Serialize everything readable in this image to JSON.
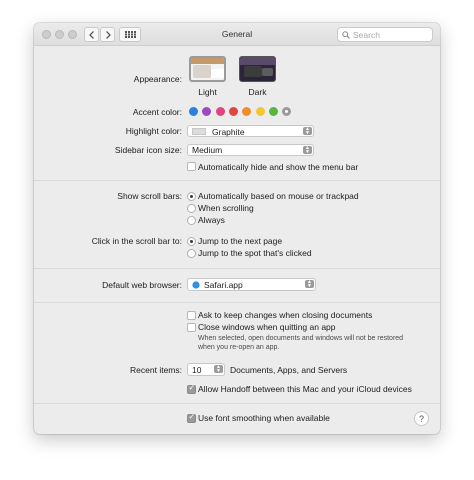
{
  "window": {
    "title": "General"
  },
  "toolbar": {
    "back_icon": "chevron-left-icon",
    "forward_icon": "chevron-right-icon",
    "grid_icon": "grid-icon",
    "search_placeholder": "Search"
  },
  "appearance": {
    "label": "Appearance:",
    "options": [
      {
        "label": "Light",
        "selected": true
      },
      {
        "label": "Dark",
        "selected": false
      }
    ]
  },
  "accent": {
    "label": "Accent color:",
    "colors": [
      "#2f7fe0",
      "#9a4bbd",
      "#e0457e",
      "#e0473f",
      "#f18d2b",
      "#f5c531",
      "#5ab442",
      "#9a9a9a"
    ],
    "selected_index": 7
  },
  "highlight": {
    "label": "Highlight color:",
    "value": "Graphite",
    "swatch": "#dcdcdc"
  },
  "sidebar_icon": {
    "label": "Sidebar icon size:",
    "value": "Medium"
  },
  "menu_bar": {
    "label": "Automatically hide and show the menu bar",
    "checked": false
  },
  "scroll_bars": {
    "label": "Show scroll bars:",
    "options": [
      {
        "label": "Automatically based on mouse or trackpad",
        "checked": true
      },
      {
        "label": "When scrolling",
        "checked": false
      },
      {
        "label": "Always",
        "checked": false
      }
    ]
  },
  "click_scroll": {
    "label": "Click in the scroll bar to:",
    "options": [
      {
        "label": "Jump to the next page",
        "checked": true
      },
      {
        "label": "Jump to the spot that's clicked",
        "checked": false
      }
    ]
  },
  "browser": {
    "label": "Default web browser:",
    "value": "Safari.app"
  },
  "documents": {
    "ask_keep": {
      "label": "Ask to keep changes when closing documents",
      "checked": false
    },
    "close_windows": {
      "label": "Close windows when quitting an app",
      "checked": false
    },
    "note_line1": "When selected, open documents and windows will not be restored",
    "note_line2": "when you re-open an app."
  },
  "recent": {
    "label": "Recent items:",
    "value": "10",
    "suffix": "Documents, Apps, and Servers"
  },
  "handoff": {
    "label": "Allow Handoff between this Mac and your iCloud devices",
    "checked": true
  },
  "font_smoothing": {
    "label": "Use font smoothing when available",
    "checked": true
  },
  "help": {
    "label": "?"
  }
}
